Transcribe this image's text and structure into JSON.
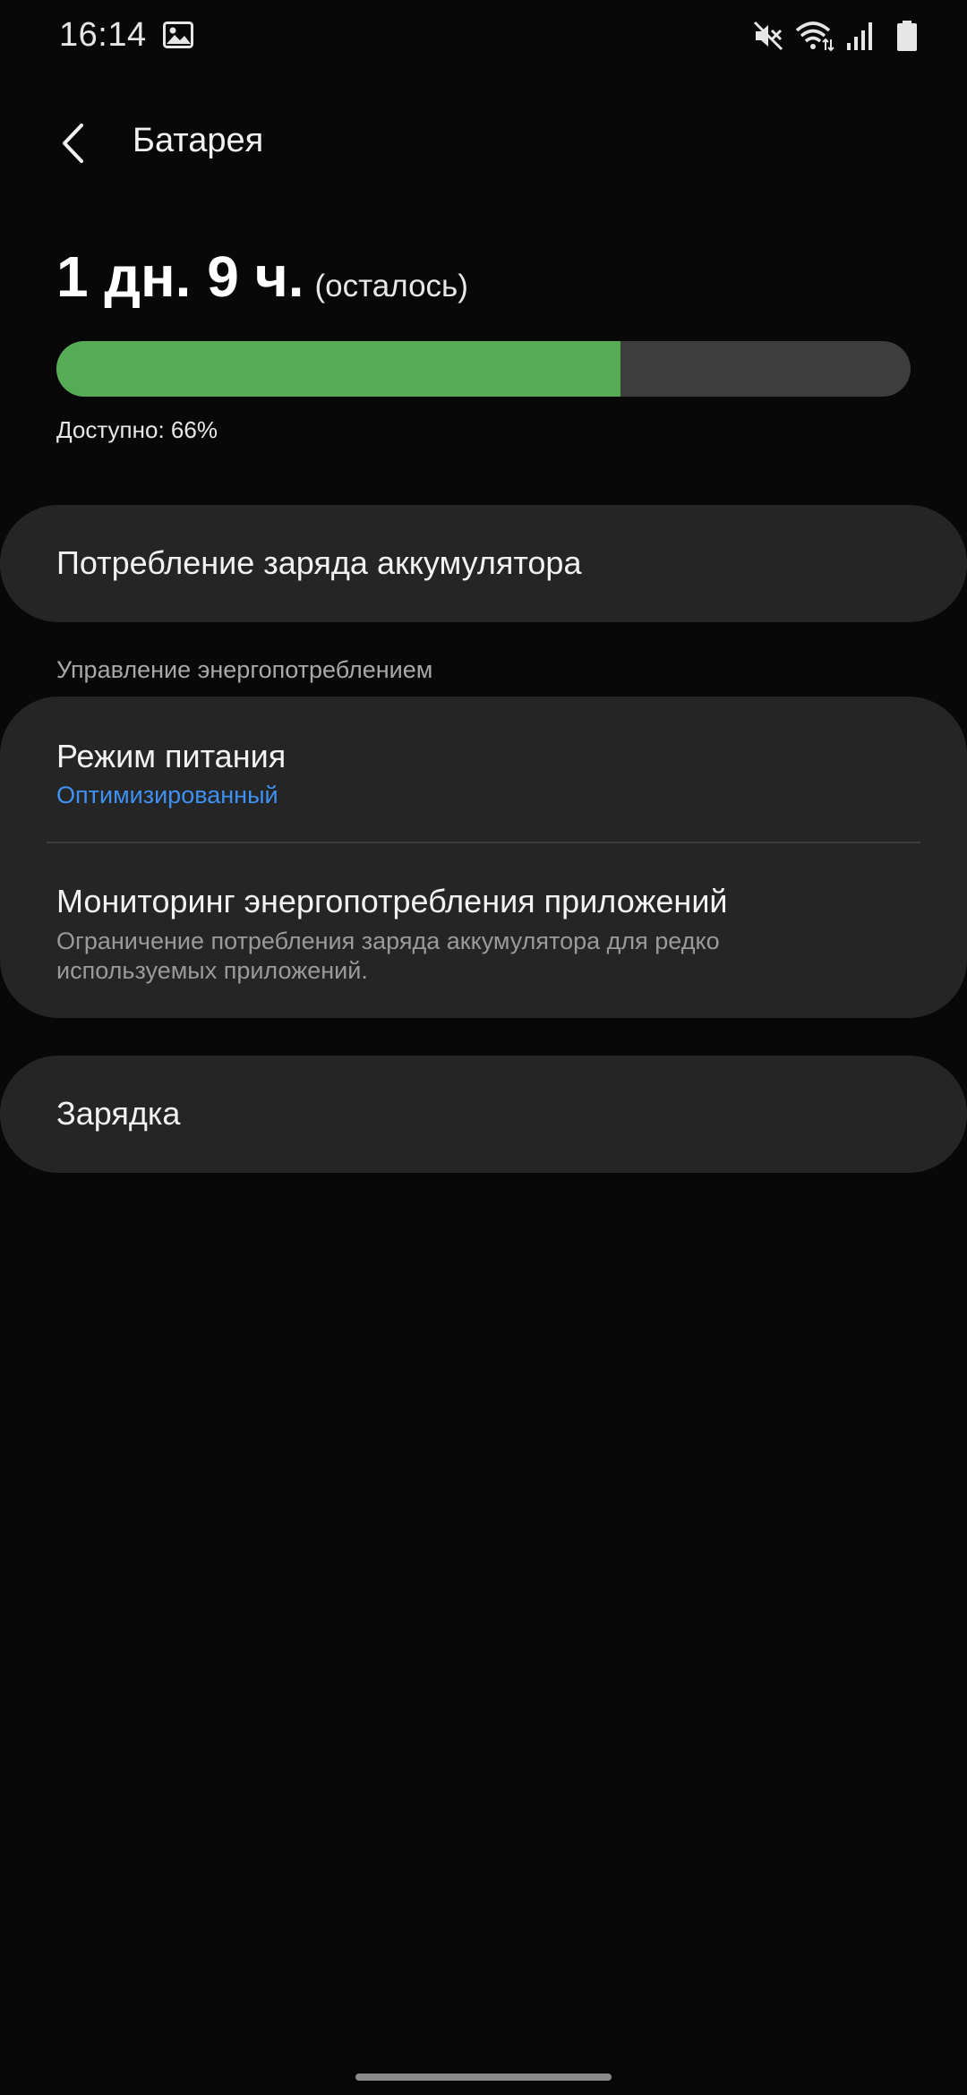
{
  "status_bar": {
    "time": "16:14",
    "icons": [
      "gallery-icon",
      "mute-icon",
      "wifi-icon",
      "signal-icon",
      "battery-icon"
    ]
  },
  "header": {
    "title": "Батарея",
    "back_icon": "chevron-left-icon"
  },
  "battery": {
    "remaining": "1 дн. 9 ч.",
    "remaining_suffix": "(осталось)",
    "level_percent": 66,
    "available_text": "Доступно: 66%",
    "fill_color": "#57ab55",
    "track_color": "#3d3d3d"
  },
  "usage": {
    "label": "Потребление заряда аккумулятора"
  },
  "power_management": {
    "section_title": "Управление энергопотреблением",
    "power_mode": {
      "title": "Режим питания",
      "value": "Оптимизированный"
    },
    "app_monitor": {
      "title": "Мониторинг энергопотребления приложений",
      "description": "Ограничение потребления заряда аккумулятора для редко используемых приложений."
    }
  },
  "charging": {
    "label": "Зарядка"
  },
  "colors": {
    "background": "#080808",
    "card": "#252525",
    "accent_blue": "#3e91f2"
  }
}
